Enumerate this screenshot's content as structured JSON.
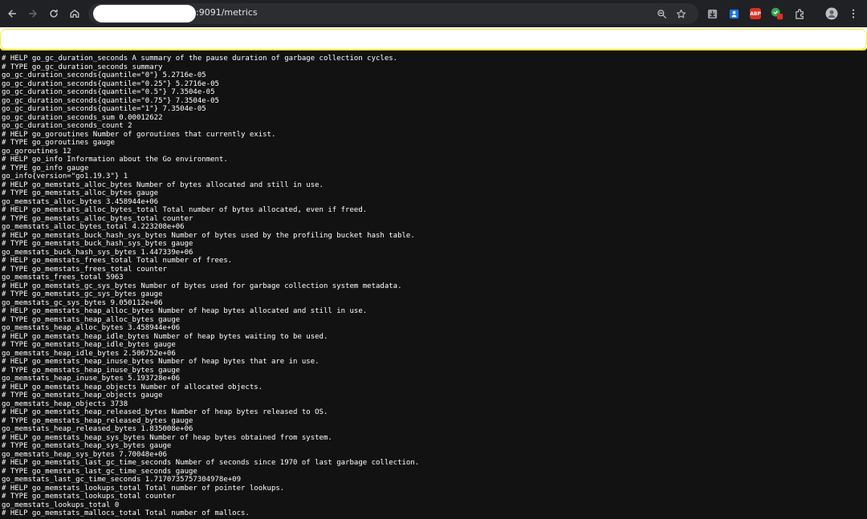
{
  "browser": {
    "url_text": ":9091/metrics",
    "icons": {
      "back": "back-arrow-icon",
      "forward": "forward-arrow-icon",
      "reload": "reload-icon",
      "home": "home-icon",
      "zoom": "zoom-icon",
      "bookmark": "star-icon",
      "download": "download-icon",
      "profile": "profile-avatar",
      "menu": "kebab-menu-icon"
    },
    "extensions": {
      "abp_label": "ABP"
    },
    "colors": {
      "toolbar_bg": "#202124",
      "page_bg": "#121212",
      "highlight": "#f5e000"
    }
  },
  "metrics_lines": [
    "# HELP go_gc_duration_seconds A summary of the pause duration of garbage collection cycles.",
    "# TYPE go_gc_duration_seconds summary",
    "go_gc_duration_seconds{quantile=\"0\"} 5.2716e-05",
    "go_gc_duration_seconds{quantile=\"0.25\"} 5.2716e-05",
    "go_gc_duration_seconds{quantile=\"0.5\"} 7.3504e-05",
    "go_gc_duration_seconds{quantile=\"0.75\"} 7.3504e-05",
    "go_gc_duration_seconds{quantile=\"1\"} 7.3504e-05",
    "go_gc_duration_seconds_sum 0.00012622",
    "go_gc_duration_seconds_count 2",
    "# HELP go_goroutines Number of goroutines that currently exist.",
    "# TYPE go_goroutines gauge",
    "go_goroutines 12",
    "# HELP go_info Information about the Go environment.",
    "# TYPE go_info gauge",
    "go_info{version=\"go1.19.3\"} 1",
    "# HELP go_memstats_alloc_bytes Number of bytes allocated and still in use.",
    "# TYPE go_memstats_alloc_bytes gauge",
    "go_memstats_alloc_bytes 3.458944e+06",
    "# HELP go_memstats_alloc_bytes_total Total number of bytes allocated, even if freed.",
    "# TYPE go_memstats_alloc_bytes_total counter",
    "go_memstats_alloc_bytes_total 4.223208e+06",
    "# HELP go_memstats_buck_hash_sys_bytes Number of bytes used by the profiling bucket hash table.",
    "# TYPE go_memstats_buck_hash_sys_bytes gauge",
    "go_memstats_buck_hash_sys_bytes 1.447339e+06",
    "# HELP go_memstats_frees_total Total number of frees.",
    "# TYPE go_memstats_frees_total counter",
    "go_memstats_frees_total 5963",
    "# HELP go_memstats_gc_sys_bytes Number of bytes used for garbage collection system metadata.",
    "# TYPE go_memstats_gc_sys_bytes gauge",
    "go_memstats_gc_sys_bytes 9.050112e+06",
    "# HELP go_memstats_heap_alloc_bytes Number of heap bytes allocated and still in use.",
    "# TYPE go_memstats_heap_alloc_bytes gauge",
    "go_memstats_heap_alloc_bytes 3.458944e+06",
    "# HELP go_memstats_heap_idle_bytes Number of heap bytes waiting to be used.",
    "# TYPE go_memstats_heap_idle_bytes gauge",
    "go_memstats_heap_idle_bytes 2.506752e+06",
    "# HELP go_memstats_heap_inuse_bytes Number of heap bytes that are in use.",
    "# TYPE go_memstats_heap_inuse_bytes gauge",
    "go_memstats_heap_inuse_bytes 5.193728e+06",
    "# HELP go_memstats_heap_objects Number of allocated objects.",
    "# TYPE go_memstats_heap_objects gauge",
    "go_memstats_heap_objects 3738",
    "# HELP go_memstats_heap_released_bytes Number of heap bytes released to OS.",
    "# TYPE go_memstats_heap_released_bytes gauge",
    "go_memstats_heap_released_bytes 1.835008e+06",
    "# HELP go_memstats_heap_sys_bytes Number of heap bytes obtained from system.",
    "# TYPE go_memstats_heap_sys_bytes gauge",
    "go_memstats_heap_sys_bytes 7.70048e+06",
    "# HELP go_memstats_last_gc_time_seconds Number of seconds since 1970 of last garbage collection.",
    "# TYPE go_memstats_last_gc_time_seconds gauge",
    "go_memstats_last_gc_time_seconds 1.7170735757304978e+09",
    "# HELP go_memstats_lookups_total Total number of pointer lookups.",
    "# TYPE go_memstats_lookups_total counter",
    "go_memstats_lookups_total 0",
    "# HELP go_memstats_mallocs_total Total number of mallocs."
  ]
}
